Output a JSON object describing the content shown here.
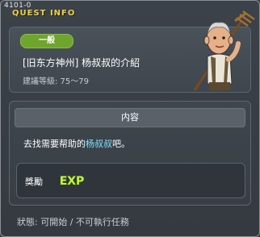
{
  "quest_id": "4101-0",
  "window_title": "QUEST INFO",
  "category": "一般",
  "quest_name": "[旧东方神州] 杨叔叔的介紹",
  "level_text": "建議等級: 75～79",
  "npc_icon": "old-man-with-pitchfork",
  "content_title": "内容",
  "description": {
    "before": "去找需要帮助的",
    "npc": "杨叔叔",
    "after": "吧。"
  },
  "reward": {
    "label": "獎勵",
    "icon": "exp-icon",
    "icon_text": "EXP"
  },
  "status": "狀態: 可開始 / 不可執行任務",
  "colors": {
    "title": "#f0d040",
    "badge": "#6fa52e",
    "npc_link": "#7fe3ff",
    "exp": "#c8f040"
  }
}
